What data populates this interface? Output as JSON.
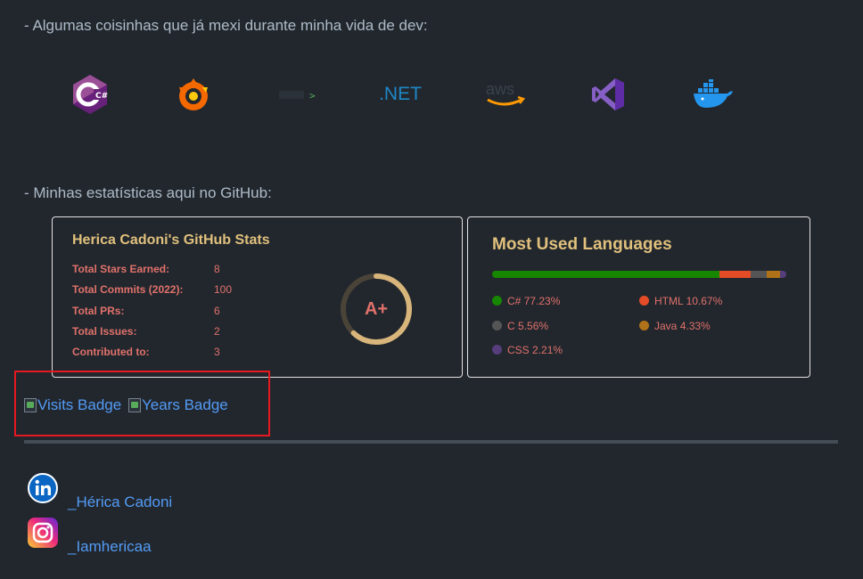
{
  "sections": {
    "tech_heading": "- Algumas coisinhas que já mexi durante minha vida de dev:",
    "stats_heading": "- Minhas estatísticas aqui no GitHub:"
  },
  "tech_icons": [
    {
      "name": "csharp-icon",
      "label": "C#"
    },
    {
      "name": "grafana-icon",
      "label": ""
    },
    {
      "name": "powershell-icon",
      "label": ">"
    },
    {
      "name": "dotnet-icon",
      "label": ".NET"
    },
    {
      "name": "aws-icon",
      "label": "aws"
    },
    {
      "name": "visual-studio-icon",
      "label": ""
    },
    {
      "name": "docker-icon",
      "label": ""
    }
  ],
  "github_stats": {
    "title": "Herica Cadoni's GitHub Stats",
    "rows": [
      {
        "label": "Total Stars Earned:",
        "value": "8"
      },
      {
        "label": "Total Commits (2022):",
        "value": "100"
      },
      {
        "label": "Total PRs:",
        "value": "6"
      },
      {
        "label": "Total Issues:",
        "value": "2"
      },
      {
        "label": "Contributed to:",
        "value": "3"
      }
    ],
    "rank": "A+",
    "rank_progress": 0.62
  },
  "languages": {
    "title": "Most Used Languages",
    "items": [
      {
        "name": "C#",
        "percent": "77.23%",
        "value": 77.23,
        "color": "#178600"
      },
      {
        "name": "HTML",
        "percent": "10.67%",
        "value": 10.67,
        "color": "#e34c26"
      },
      {
        "name": "C",
        "percent": "5.56%",
        "value": 5.56,
        "color": "#555555"
      },
      {
        "name": "Java",
        "percent": "4.33%",
        "value": 4.33,
        "color": "#b07219"
      },
      {
        "name": "CSS",
        "percent": "2.21%",
        "value": 2.21,
        "color": "#563d7c"
      }
    ]
  },
  "badges": {
    "visits": "Visits Badge",
    "years": "Years Badge"
  },
  "social": {
    "linkedin": "_Hérica Cadoni",
    "instagram": "_Iamhericaa"
  },
  "colors": {
    "background": "#22272e",
    "link": "#539bf5",
    "card_title": "#e0c07c",
    "card_text": "#e0716a",
    "highlight": "#e5191f"
  }
}
